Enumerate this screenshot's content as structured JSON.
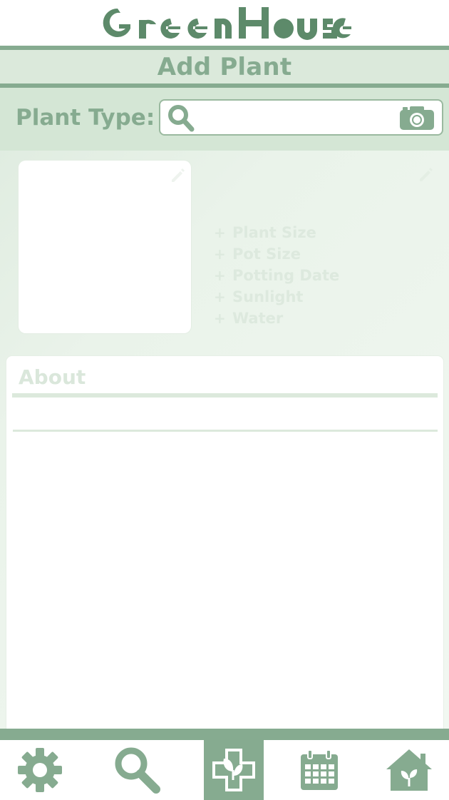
{
  "app": {
    "name": "GreenHouse"
  },
  "header": {
    "title": "Add Plant"
  },
  "plant_type": {
    "label": "Plant Type:",
    "search_value": "",
    "search_icon": "search-icon",
    "camera_icon": "camera-icon"
  },
  "details": {
    "items": [
      {
        "prefix": "+",
        "label": "Plant Size"
      },
      {
        "prefix": "+",
        "label": "Pot Size"
      },
      {
        "prefix": "+",
        "label": "Potting Date"
      },
      {
        "prefix": "+",
        "label": "Sunlight"
      },
      {
        "prefix": "+",
        "label": "Water"
      }
    ]
  },
  "about": {
    "title": "About"
  },
  "nav": {
    "items": [
      {
        "icon": "gear-icon",
        "active": false
      },
      {
        "icon": "search-icon",
        "active": false
      },
      {
        "icon": "add-plant-icon",
        "active": true
      },
      {
        "icon": "calendar-icon",
        "active": false
      },
      {
        "icon": "greenhouse-home-icon",
        "active": false
      }
    ]
  },
  "colors": {
    "accent": "#86ab90",
    "header_band": "#dbe9db",
    "light_text": "#dde9de",
    "background": "#e3efe3"
  }
}
